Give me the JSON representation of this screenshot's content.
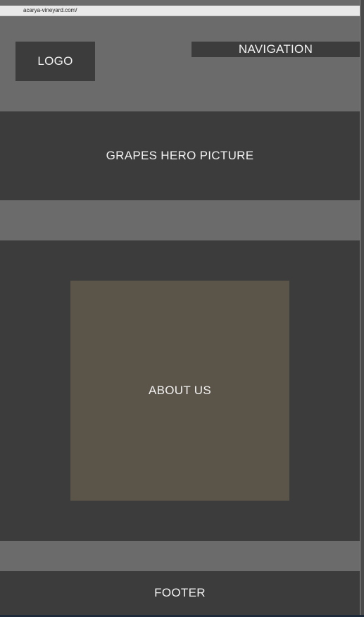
{
  "browser": {
    "url": "acarya-vineyard.com/"
  },
  "header": {
    "logo_label": "LOGO",
    "navigation_label": "NAVIGATION"
  },
  "hero": {
    "label": "GRAPES HERO PICTURE"
  },
  "about": {
    "label": "ABOUT US"
  },
  "footer": {
    "label": "FOOTER"
  },
  "colors": {
    "light_gray": "#6b6b6b",
    "dark_gray": "#3c3c3c",
    "about_brown": "#5b5449",
    "text": "#f2f2f2"
  }
}
